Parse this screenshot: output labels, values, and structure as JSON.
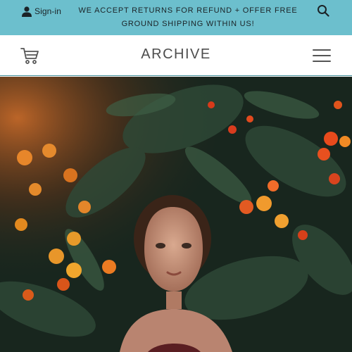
{
  "topbar": {
    "signin_label": "Sign-in",
    "announcement": "WE ACCEPT RETURNS FOR REFUND + OFFER FREE GROUND SHIPPING WITHIN US!",
    "search_icon": "search-icon",
    "user_icon": "user-icon",
    "background_color": "#6cbfcd"
  },
  "header": {
    "logo_text": "ARCHIVE",
    "cart_icon": "cart-icon",
    "menu_icon": "hamburger-menu-icon"
  },
  "hero": {
    "image": "hero-photo"
  }
}
